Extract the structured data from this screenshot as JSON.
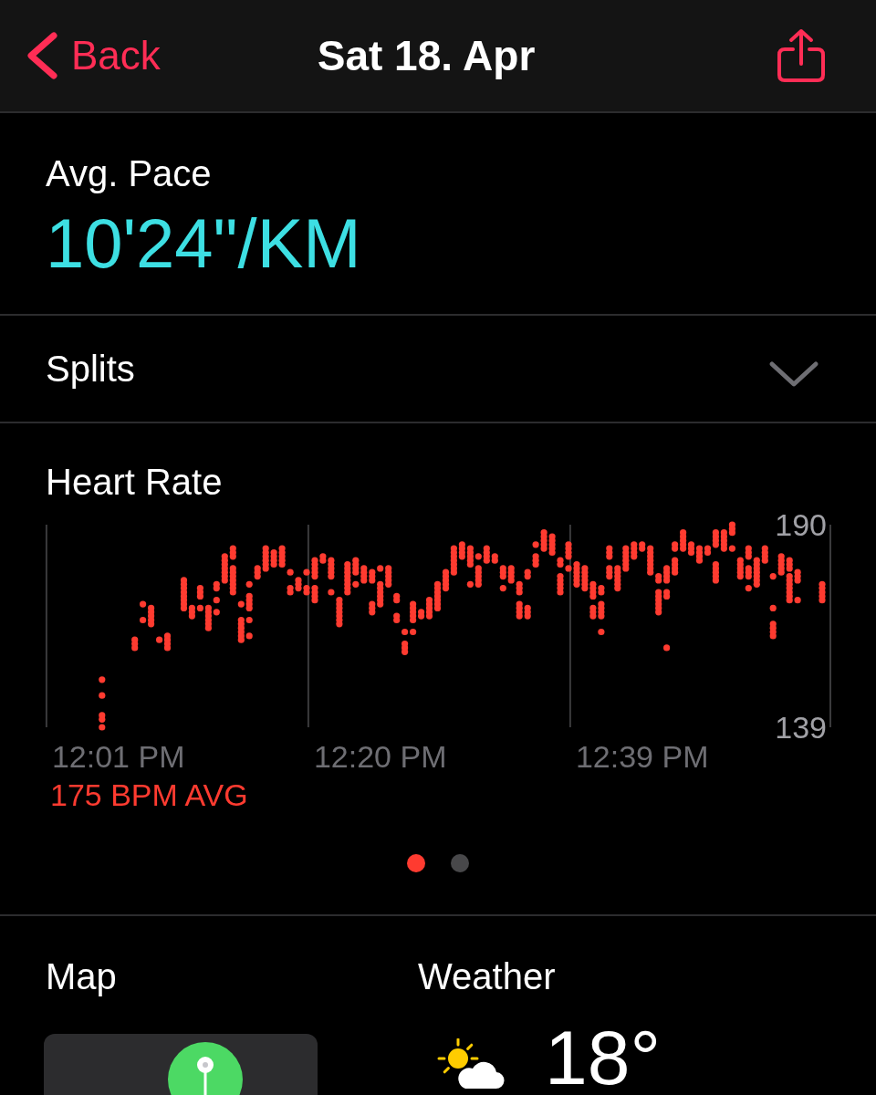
{
  "nav": {
    "back": "Back",
    "title": "Sat 18. Apr"
  },
  "pace": {
    "label": "Avg. Pace",
    "value": "10'24\"/KM"
  },
  "splits": {
    "label": "Splits",
    "expanded": false
  },
  "heart_rate": {
    "title": "Heart Rate",
    "chart_data": {
      "type": "scatter",
      "categories": [
        null,
        null,
        null,
        null,
        null,
        null,
        null,
        null,
        null,
        "12:01 PM",
        null,
        null,
        null,
        null,
        null,
        null,
        null,
        null,
        null,
        null,
        null,
        null,
        null,
        null,
        null,
        null,
        null,
        null,
        null,
        null,
        null,
        null,
        null,
        null,
        null,
        null,
        null,
        null,
        null,
        null,
        null,
        "12:20 PM",
        null,
        null,
        null,
        null,
        null,
        null,
        null,
        null,
        null,
        null,
        null,
        null,
        null,
        null,
        null,
        null,
        null,
        null,
        null,
        null,
        null,
        null,
        null,
        null,
        null,
        null,
        null,
        null,
        null,
        null,
        null,
        "12:39 PM",
        null,
        null,
        null,
        null,
        null,
        null,
        null,
        null,
        null,
        null,
        null,
        null,
        null,
        null,
        null,
        null,
        null,
        null,
        null,
        null,
        null,
        null
      ],
      "series": [
        {
          "color": "#ff3b30",
          "values": [
            null,
            null,
            null,
            null,
            null,
            null,
            null,
            139,
            null,
            null,
            null,
            159,
            166,
            165,
            161,
            159,
            null,
            169,
            167,
            169,
            164,
            168,
            176,
            173,
            161,
            162,
            177,
            179,
            180,
            180,
            173,
            174,
            173,
            171,
            181,
            173,
            165,
            173,
            175,
            176,
            168,
            170,
            175,
            166,
            158,
            163,
            167,
            167,
            169,
            174,
            178,
            182,
            175,
            175,
            181,
            181,
            174,
            176,
            167,
            167,
            180,
            184,
            183,
            173,
            179,
            175,
            174,
            167,
            163,
            177,
            174,
            179,
            182,
            184,
            178,
            168,
            159,
            178,
            184,
            183,
            181,
            183,
            176,
            184,
            184,
            177,
            174,
            175,
            181,
            162,
            178,
            171,
            171,
            null,
            null,
            171
          ]
        },
        {
          "color": "#ff3b30",
          "values": [
            null,
            null,
            null,
            null,
            null,
            null,
            null,
            141,
            null,
            null,
            null,
            160,
            170,
            166,
            null,
            160,
            null,
            170,
            168,
            172,
            165,
            171,
            177,
            174,
            162,
            166,
            178,
            180,
            181,
            181,
            174,
            175,
            174,
            172,
            182,
            177,
            166,
            174,
            178,
            177,
            169,
            171,
            176,
            167,
            159,
            166,
            168,
            168,
            170,
            175,
            179,
            183,
            180,
            176,
            182,
            182,
            177,
            177,
            168,
            168,
            181,
            185,
            184,
            174,
            182,
            176,
            175,
            168,
            167,
            178,
            175,
            180,
            183,
            185,
            179,
            169,
            172,
            179,
            185,
            184,
            182,
            184,
            177,
            185,
            188,
            178,
            177,
            176,
            182,
            163,
            179,
            172,
            176,
            null,
            null,
            172
          ]
        },
        {
          "color": "#ff3b30",
          "values": [
            null,
            null,
            null,
            null,
            null,
            null,
            null,
            142,
            null,
            null,
            null,
            161,
            null,
            167,
            null,
            161,
            null,
            171,
            169,
            173,
            166,
            174,
            178,
            175,
            163,
            169,
            179,
            181,
            182,
            182,
            178,
            176,
            178,
            173,
            null,
            178,
            167,
            175,
            179,
            178,
            170,
            172,
            177,
            171,
            160,
            167,
            null,
            169,
            171,
            176,
            180,
            184,
            181,
            177,
            183,
            null,
            178,
            178,
            169,
            169,
            182,
            186,
            185,
            175,
            183,
            177,
            176,
            169,
            168,
            179,
            176,
            181,
            184,
            null,
            180,
            170,
            173,
            180,
            186,
            185,
            183,
            null,
            178,
            186,
            189,
            179,
            178,
            177,
            183,
            164,
            180,
            173,
            177,
            null,
            null,
            173
          ]
        },
        {
          "color": "#ff3b30",
          "values": [
            null,
            null,
            null,
            null,
            null,
            null,
            null,
            147,
            null,
            null,
            null,
            null,
            null,
            168,
            null,
            162,
            null,
            172,
            null,
            174,
            167,
            175,
            179,
            176,
            164,
            170,
            null,
            182,
            183,
            183,
            null,
            null,
            null,
            174,
            null,
            179,
            168,
            176,
            180,
            179,
            176,
            173,
            178,
            172,
            163,
            168,
            null,
            170,
            172,
            177,
            181,
            185,
            182,
            178,
            184,
            null,
            179,
            179,
            170,
            177,
            185,
            187,
            186,
            176,
            184,
            178,
            177,
            172,
            169,
            182,
            177,
            182,
            185,
            null,
            181,
            171,
            176,
            181,
            187,
            null,
            184,
            null,
            179,
            187,
            190,
            180,
            179,
            178,
            184,
            165,
            181,
            174,
            178,
            null,
            null,
            174
          ]
        },
        {
          "color": "#ff3b30",
          "values": [
            null,
            null,
            null,
            null,
            null,
            null,
            null,
            151,
            null,
            null,
            null,
            null,
            null,
            169,
            null,
            null,
            null,
            173,
            null,
            null,
            168,
            null,
            180,
            177,
            165,
            171,
            null,
            183,
            null,
            184,
            null,
            null,
            null,
            177,
            null,
            180,
            169,
            177,
            181,
            null,
            177,
            174,
            179,
            null,
            null,
            169,
            null,
            171,
            173,
            178,
            182,
            null,
            183,
            179,
            null,
            null,
            null,
            null,
            173,
            178,
            null,
            188,
            187,
            177,
            185,
            179,
            178,
            173,
            170,
            183,
            178,
            183,
            null,
            null,
            182,
            172,
            177,
            184,
            188,
            null,
            null,
            null,
            180,
            188,
            null,
            181,
            182,
            179,
            null,
            169,
            182,
            175,
            null,
            null,
            null,
            175
          ]
        },
        {
          "color": "#ff3b30",
          "values": [
            null,
            null,
            null,
            null,
            null,
            null,
            null,
            null,
            null,
            null,
            null,
            null,
            null,
            null,
            null,
            null,
            null,
            174,
            null,
            null,
            169,
            null,
            181,
            178,
            166,
            172,
            null,
            184,
            null,
            null,
            null,
            null,
            null,
            178,
            null,
            181,
            170,
            178,
            null,
            null,
            178,
            175,
            null,
            null,
            null,
            170,
            null,
            null,
            174,
            null,
            183,
            null,
            184,
            182,
            null,
            null,
            null,
            null,
            174,
            null,
            null,
            null,
            null,
            180,
            null,
            180,
            179,
            174,
            173,
            184,
            179,
            184,
            null,
            null,
            183,
            173,
            178,
            185,
            null,
            null,
            null,
            null,
            185,
            null,
            null,
            null,
            183,
            180,
            null,
            177,
            null,
            176,
            null,
            null,
            null,
            null
          ]
        },
        {
          "color": "#ff3b30",
          "values": [
            null,
            null,
            null,
            null,
            null,
            null,
            null,
            null,
            null,
            null,
            null,
            null,
            null,
            null,
            null,
            null,
            null,
            175,
            null,
            null,
            null,
            null,
            182,
            179,
            170,
            175,
            null,
            null,
            null,
            null,
            null,
            null,
            null,
            179,
            null,
            null,
            171,
            179,
            null,
            null,
            null,
            179,
            null,
            null,
            null,
            null,
            null,
            null,
            175,
            null,
            184,
            null,
            null,
            null,
            null,
            null,
            null,
            null,
            175,
            null,
            null,
            null,
            null,
            181,
            null,
            null,
            null,
            175,
            174,
            null,
            null,
            null,
            null,
            null,
            184,
            176,
            179,
            null,
            null,
            null,
            null,
            null,
            186,
            null,
            null,
            null,
            184,
            181,
            null,
            null,
            null,
            177,
            null,
            null,
            null,
            null
          ]
        },
        {
          "color": "#ff3b30",
          "values": [
            null,
            null,
            null,
            null,
            null,
            null,
            null,
            null,
            null,
            null,
            null,
            null,
            null,
            null,
            null,
            null,
            null,
            176,
            null,
            null,
            null,
            null,
            null,
            182,
            null,
            null,
            null,
            null,
            null,
            null,
            null,
            null,
            null,
            180,
            null,
            null,
            null,
            180,
            null,
            null,
            null,
            null,
            null,
            null,
            null,
            null,
            null,
            null,
            null,
            null,
            null,
            null,
            null,
            null,
            null,
            null,
            null,
            null,
            null,
            null,
            null,
            null,
            null,
            null,
            null,
            null,
            null,
            null,
            null,
            null,
            null,
            null,
            null,
            null,
            null,
            177,
            null,
            null,
            null,
            null,
            null,
            null,
            187,
            null,
            null,
            null,
            null,
            null,
            null,
            null,
            null,
            179,
            null,
            null,
            null,
            null
          ]
        },
        {
          "color": "#ff3b30",
          "values": [
            null,
            null,
            null,
            null,
            null,
            null,
            null,
            null,
            null,
            null,
            null,
            null,
            null,
            null,
            null,
            null,
            null,
            null,
            null,
            null,
            null,
            null,
            null,
            183,
            null,
            null,
            null,
            null,
            null,
            null,
            null,
            null,
            null,
            181,
            null,
            null,
            null,
            null,
            null,
            null,
            null,
            null,
            null,
            null,
            null,
            null,
            null,
            null,
            null,
            null,
            null,
            null,
            null,
            null,
            null,
            null,
            null,
            null,
            null,
            null,
            null,
            null,
            null,
            null,
            null,
            null,
            null,
            null,
            null,
            null,
            null,
            null,
            null,
            null,
            null,
            null,
            null,
            null,
            null,
            null,
            null,
            null,
            188,
            null,
            null,
            null,
            null,
            null,
            null,
            null,
            null,
            180,
            null,
            null,
            null,
            null
          ]
        },
        {
          "color": "#ff3b30",
          "values": [
            null,
            null,
            null,
            null,
            null,
            null,
            null,
            null,
            null,
            null,
            null,
            null,
            null,
            null,
            null,
            null,
            null,
            null,
            null,
            null,
            null,
            null,
            null,
            184,
            null,
            null,
            null,
            null,
            null,
            null,
            null,
            null,
            null,
            null,
            null,
            null,
            null,
            null,
            null,
            null,
            null,
            null,
            null,
            null,
            null,
            null,
            null,
            null,
            null,
            null,
            null,
            null,
            null,
            null,
            null,
            null,
            null,
            null,
            null,
            null,
            null,
            null,
            null,
            null,
            null,
            null,
            null,
            null,
            null,
            null,
            null,
            null,
            null,
            null,
            null,
            null,
            null,
            null,
            null,
            null,
            null,
            null,
            null,
            null,
            null,
            null,
            null,
            null,
            null,
            null,
            null,
            181,
            null,
            null,
            null,
            null
          ]
        }
      ],
      "ylim": [
        139,
        190
      ],
      "yticks": [
        139,
        190
      ]
    },
    "average": "175 BPM AVG"
  },
  "pager": [
    {
      "selected": true
    },
    {
      "selected": false
    }
  ],
  "map": {
    "title": "Map"
  },
  "weather": {
    "title": "Weather",
    "temperature": "18°"
  }
}
